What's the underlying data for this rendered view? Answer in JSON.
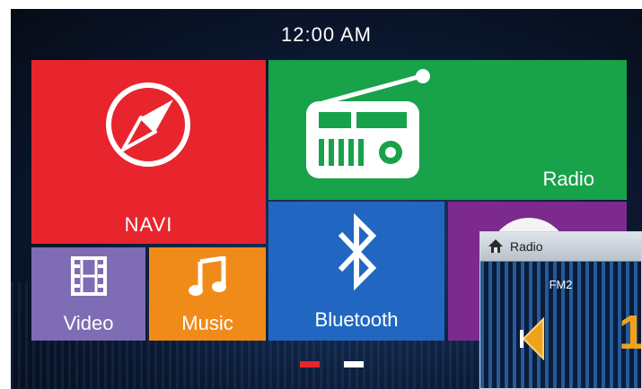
{
  "status": {
    "time": "12:00 AM"
  },
  "tiles": {
    "navi": {
      "label": "NAVI",
      "icon": "compass-icon",
      "color": "#e8242d"
    },
    "radio": {
      "label": "Radio",
      "icon": "radio-icon",
      "color": "#18a24a"
    },
    "bluetooth": {
      "label": "Bluetooth",
      "icon": "bluetooth-icon",
      "color": "#2167c1"
    },
    "video": {
      "label": "Video",
      "icon": "film-icon",
      "color": "#7e6cb4"
    },
    "music": {
      "label": "Music",
      "icon": "music-note-icon",
      "color": "#f08b1a"
    },
    "extra": {
      "icon": "circle-icon",
      "color": "#7c2a8e"
    }
  },
  "pager": {
    "pages": 2,
    "active_page": 1,
    "active_color": "#e8242d",
    "inactive_color": "#ffffff"
  },
  "radio_popup": {
    "title": "Radio",
    "home_icon": "home-icon",
    "band": "FM2",
    "prev_icon": "prev-arrow-icon",
    "frequency_partial": "1",
    "accent": "#f0a31a"
  }
}
